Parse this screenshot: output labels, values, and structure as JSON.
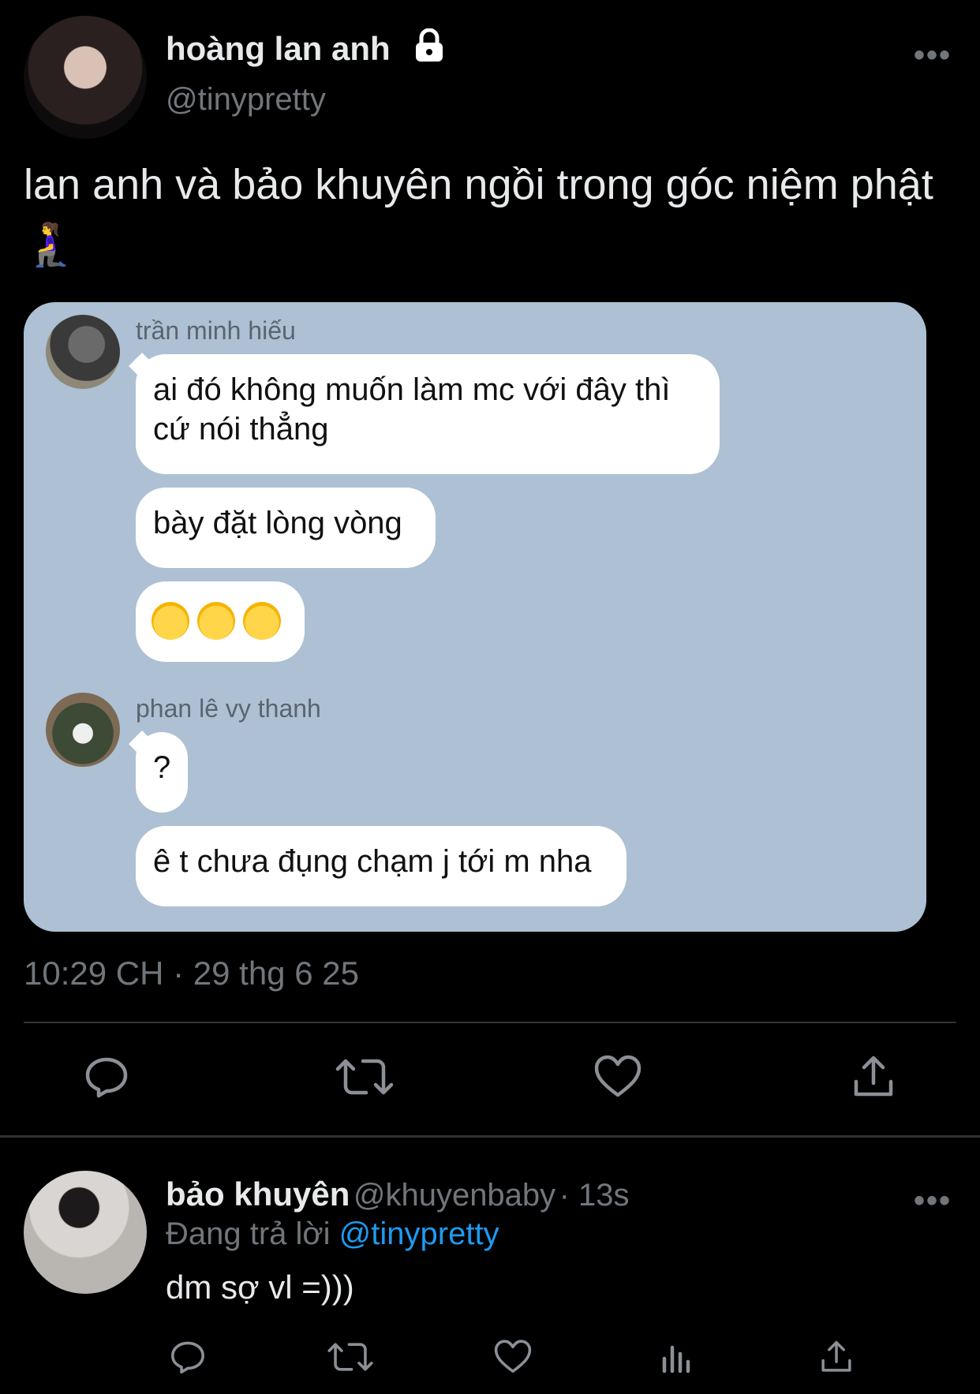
{
  "tweet": {
    "author_name": "hoàng lan anh",
    "author_handle": "@tinypretty",
    "locked_icon": "lock-icon",
    "more_icon": "more-icon",
    "text": "lan anh và bảo khuyên ngồi trong góc niệm phật 🧎‍♀️",
    "timestamp": "10:29 CH · 29 thg 6 25"
  },
  "chat": {
    "sender1": "trần minh hiếu",
    "messages1": [
      "ai đó không muốn làm mc với đây thì cứ nói thẳng",
      "bày đặt lòng vòng",
      "😅😅😅"
    ],
    "sender2": "phan lê vy thanh",
    "messages2": [
      "?",
      "ê t chưa đụng chạm j tới m nha"
    ]
  },
  "actions": {
    "icons": [
      "reply-icon",
      "retweet-icon",
      "like-icon",
      "share-icon"
    ]
  },
  "reply": {
    "author_name": "bảo khuyên",
    "author_handle": "@khuyenbaby",
    "time": "· 13s",
    "replying_prefix": "Đang trả lời",
    "replying_to": "@tinypretty",
    "text": "dm sợ vl =)))",
    "icons": [
      "reply-icon",
      "retweet-icon",
      "like-icon",
      "views-icon",
      "share-icon"
    ]
  }
}
